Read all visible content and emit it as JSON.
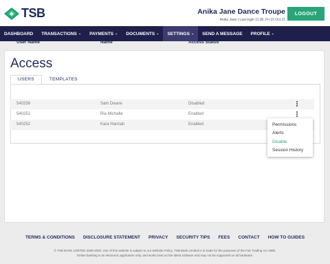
{
  "brand": {
    "name": "TSB"
  },
  "header": {
    "user_name": "Anika Jane Dance Troupe",
    "last_login": "Anika Jane  |  Last login 11:30, Fri 15 Oct 21",
    "logout_label": "LOGOUT",
    "logout_color": "#2aa57a"
  },
  "nav": {
    "items": [
      {
        "label": "DASHBOARD",
        "dropdown": false
      },
      {
        "label": "TRANSACTIONS",
        "dropdown": true
      },
      {
        "label": "PAYMENTS",
        "dropdown": true
      },
      {
        "label": "DOCUMENTS",
        "dropdown": true
      },
      {
        "label": "SETTINGS",
        "dropdown": true,
        "active": true
      },
      {
        "label": "SEND A MESSAGE",
        "dropdown": false
      },
      {
        "label": "PROFILE",
        "dropdown": true
      }
    ],
    "background": "#1f1f4b"
  },
  "main": {
    "title": "Access",
    "tabs": [
      {
        "label": "USERS",
        "active": true
      },
      {
        "label": "TEMPLATES",
        "active": false
      }
    ],
    "table": {
      "headers": [
        "User Name",
        "Name",
        "Access Status"
      ],
      "rows": [
        {
          "user_name": "540256",
          "name": "Sam Deane",
          "status": "Disabled"
        },
        {
          "user_name": "540251",
          "name": "Ria Michelle",
          "status": "Enabled"
        },
        {
          "user_name": "540252",
          "name": "Kara Hannah",
          "status": "Enabled"
        }
      ]
    },
    "context_menu": {
      "items": [
        "Permissions",
        "Alerts",
        "Disable",
        "Session History"
      ],
      "highlighted": "Disable"
    }
  },
  "footer": {
    "links": [
      "TERMS & CONDITIONS",
      "DISCLOSURE STATEMENT",
      "PRIVACY",
      "SECURITY TIPS",
      "FEES",
      "CONTACT",
      "HOW TO GUIDES"
    ],
    "legal_line1": "© TSB BANK LIMITED 2008-2020. Use of this website is subject to our Website Policy. TSB Bank Limited is in trade for the purposes of the Fair Trading Act 1986.",
    "legal_line2": "Online banking is an electronic application only, and works best on the latest software and may not be supported on all hardware."
  },
  "icons": {
    "logo": "tsb-diamond-logo",
    "menu": "kebab-menu-icon",
    "dropdown": "chevron-down-icon"
  }
}
